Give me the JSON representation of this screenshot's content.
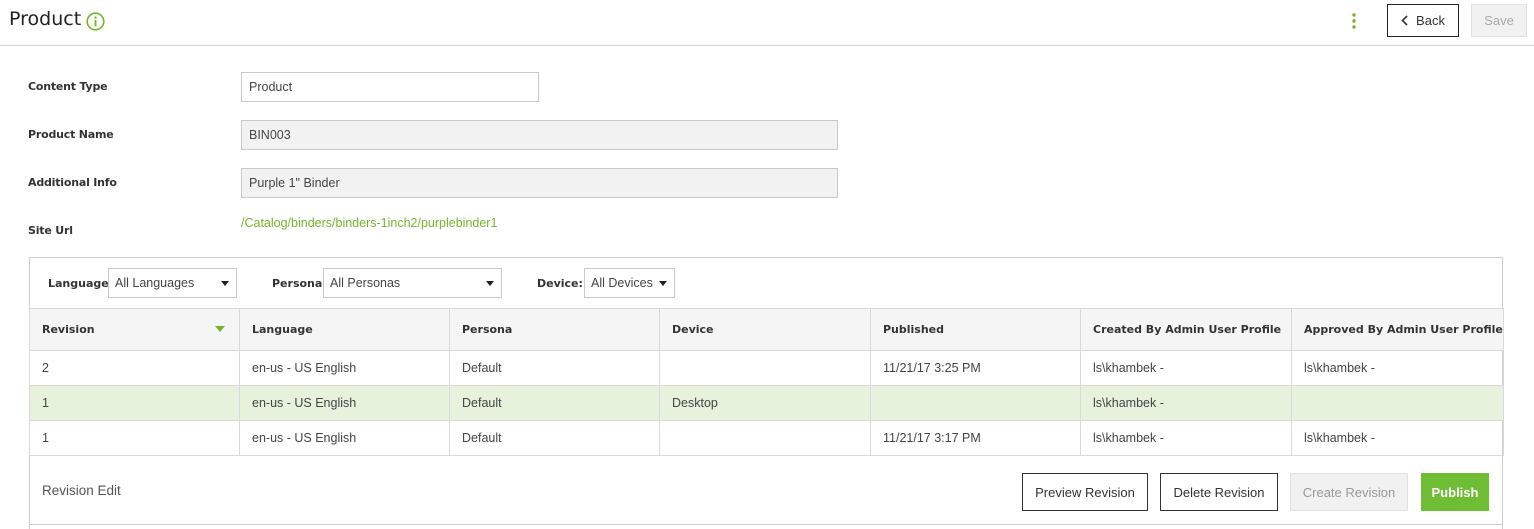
{
  "header": {
    "title": "Product",
    "info_icon": "info-circle-icon",
    "menu_icon": "kebab-menu-icon",
    "back_label": "Back",
    "save_label": "Save",
    "accent_color": "#73b62b"
  },
  "form": {
    "content_type": {
      "label": "Content Type",
      "value": "Product"
    },
    "product_name": {
      "label": "Product Name",
      "value": "BIN003"
    },
    "additional_info": {
      "label": "Additional Info",
      "value": "Purple 1\" Binder"
    },
    "site_url": {
      "label": "Site Url",
      "value": "/Catalog/binders/binders-1inch2/purplebinder1"
    }
  },
  "filters": {
    "language": {
      "label": "Language",
      "value": "All Languages"
    },
    "persona": {
      "label": "Persona",
      "value": "All Personas"
    },
    "device": {
      "label": "Device:",
      "value": "All Devices"
    }
  },
  "table": {
    "columns": [
      "Revision",
      "Language",
      "Persona",
      "Device",
      "Published",
      "Created By Admin User Profile",
      "Approved By Admin User Profile"
    ],
    "rows": [
      [
        "2",
        "en-us - US English",
        "Default",
        "",
        "11/21/17 3:25 PM",
        "ls\\khambek -",
        "ls\\khambek -"
      ],
      [
        "1",
        "en-us - US English",
        "Default",
        "Desktop",
        "",
        "ls\\khambek -",
        ""
      ],
      [
        "1",
        "en-us - US English",
        "Default",
        "",
        "11/21/17 3:17 PM",
        "ls\\khambek -",
        "ls\\khambek -"
      ]
    ],
    "selected_row": 1,
    "sort_column": "Revision",
    "sort_direction": "descending"
  },
  "footer": {
    "title": "Revision Edit",
    "preview_label": "Preview Revision",
    "delete_label": "Delete Revision",
    "create_label": "Create Revision",
    "publish_label": "Publish"
  }
}
